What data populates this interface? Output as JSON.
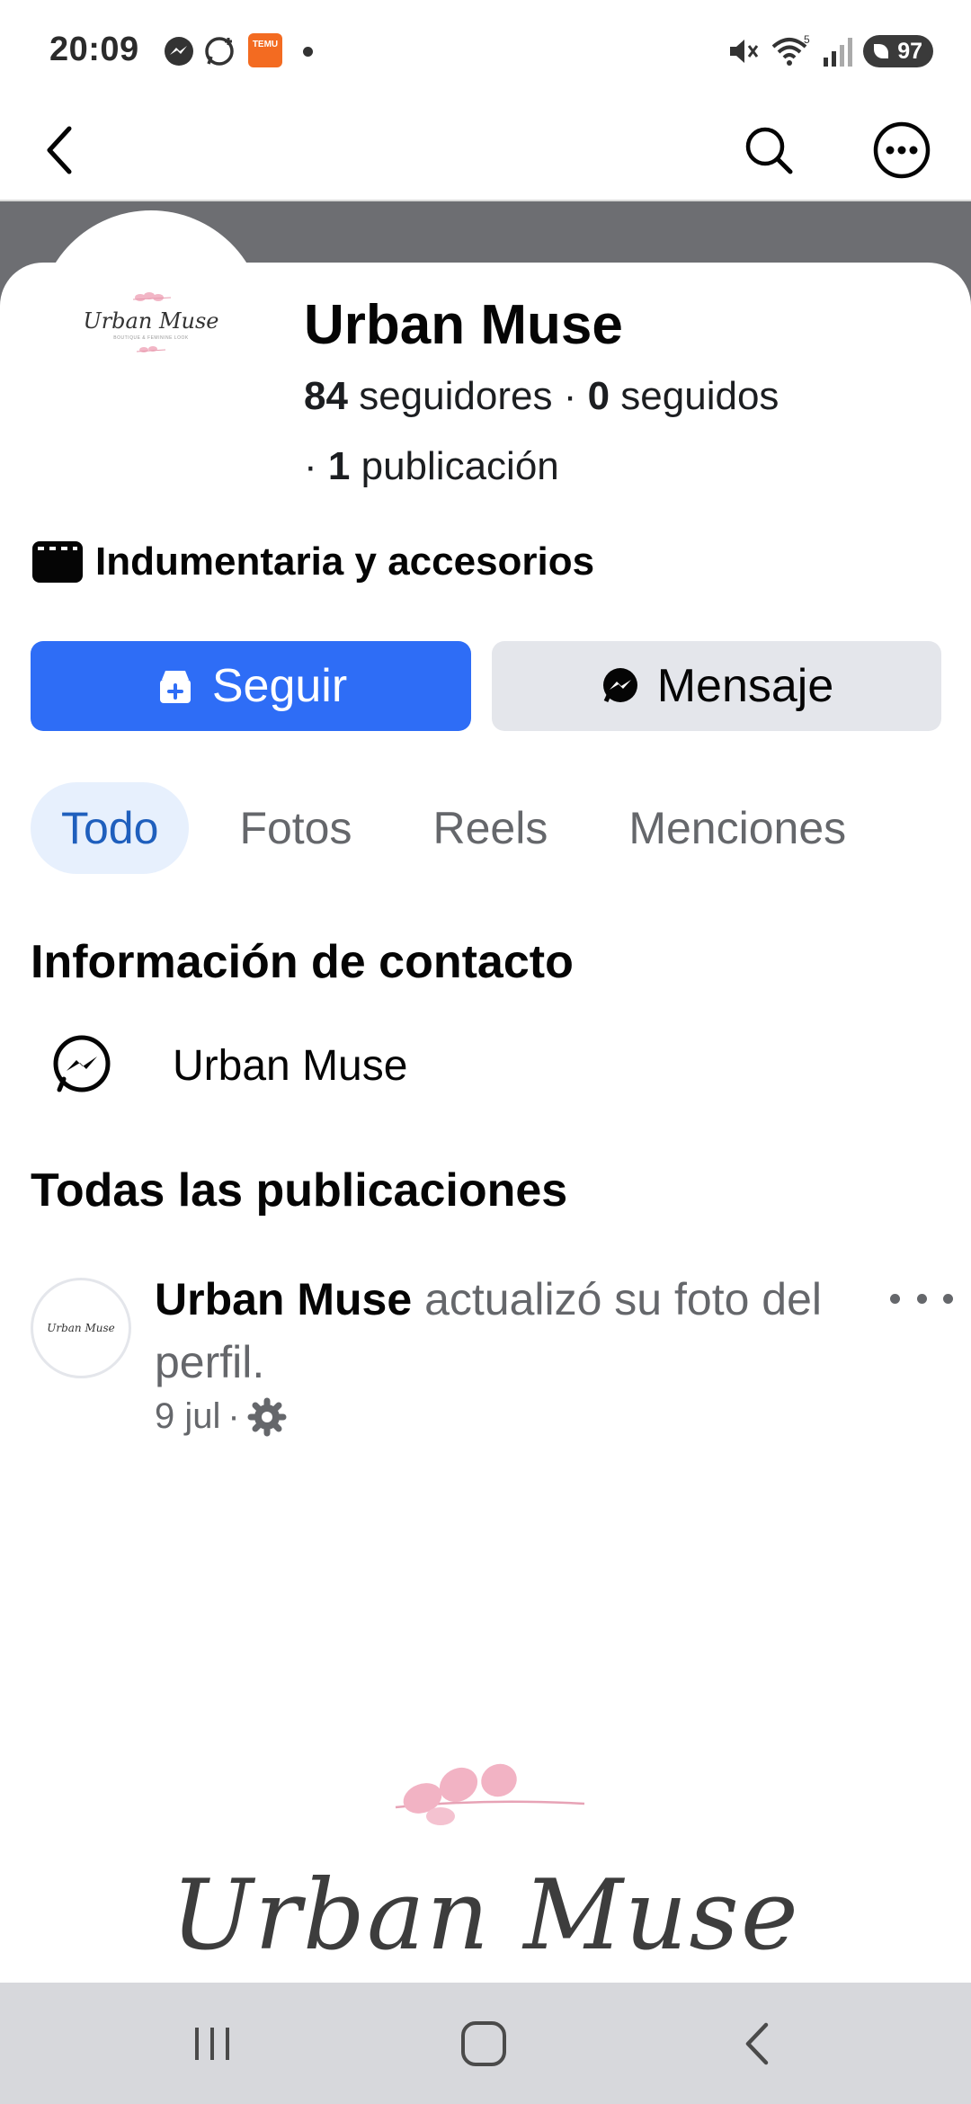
{
  "status_bar": {
    "time": "20:09",
    "notification_icons": [
      "messenger-icon",
      "whatsapp-icon",
      "temu-app-icon"
    ],
    "temu_label": "TEMU",
    "battery": "97"
  },
  "header": {
    "back_icon": "chevron-left-icon",
    "search_icon": "search-icon",
    "more_icon": "more-circle-icon"
  },
  "profile": {
    "name": "Urban Muse",
    "avatar_brand": "Urban Muse",
    "avatar_sub": "BOUTIQUE & FEMININE LOOK",
    "followers_count": "84",
    "followers_label": "seguidores",
    "following_count": "0",
    "following_label": "seguidos",
    "posts_prefix": "·",
    "posts_count": "1",
    "posts_label": "publicación",
    "separator": "·",
    "category": "Indumentaria y accesorios"
  },
  "actions": {
    "follow_label": "Seguir",
    "message_label": "Mensaje"
  },
  "tabs": [
    {
      "label": "Todo",
      "active": true
    },
    {
      "label": "Fotos",
      "active": false
    },
    {
      "label": "Reels",
      "active": false
    },
    {
      "label": "Menciones",
      "active": false
    }
  ],
  "contact": {
    "title": "Información de contacto",
    "messenger_name": "Urban Muse"
  },
  "posts_section": {
    "title": "Todas las publicaciones",
    "post": {
      "author": "Urban Muse",
      "action_text": "actualizó su foto del perfil.",
      "date": "9 jul",
      "separator": "·",
      "image_brand": "Urban Muse",
      "avatar_brand": "Urban Muse"
    }
  },
  "colors": {
    "primary_blue": "#2e6df6",
    "tab_active_bg": "#e7f0fd",
    "tab_active_text": "#1f5fbd",
    "secondary_button": "#e4e6eb",
    "cover": "#6d6e72",
    "nav_bar": "#d7d8dc"
  }
}
